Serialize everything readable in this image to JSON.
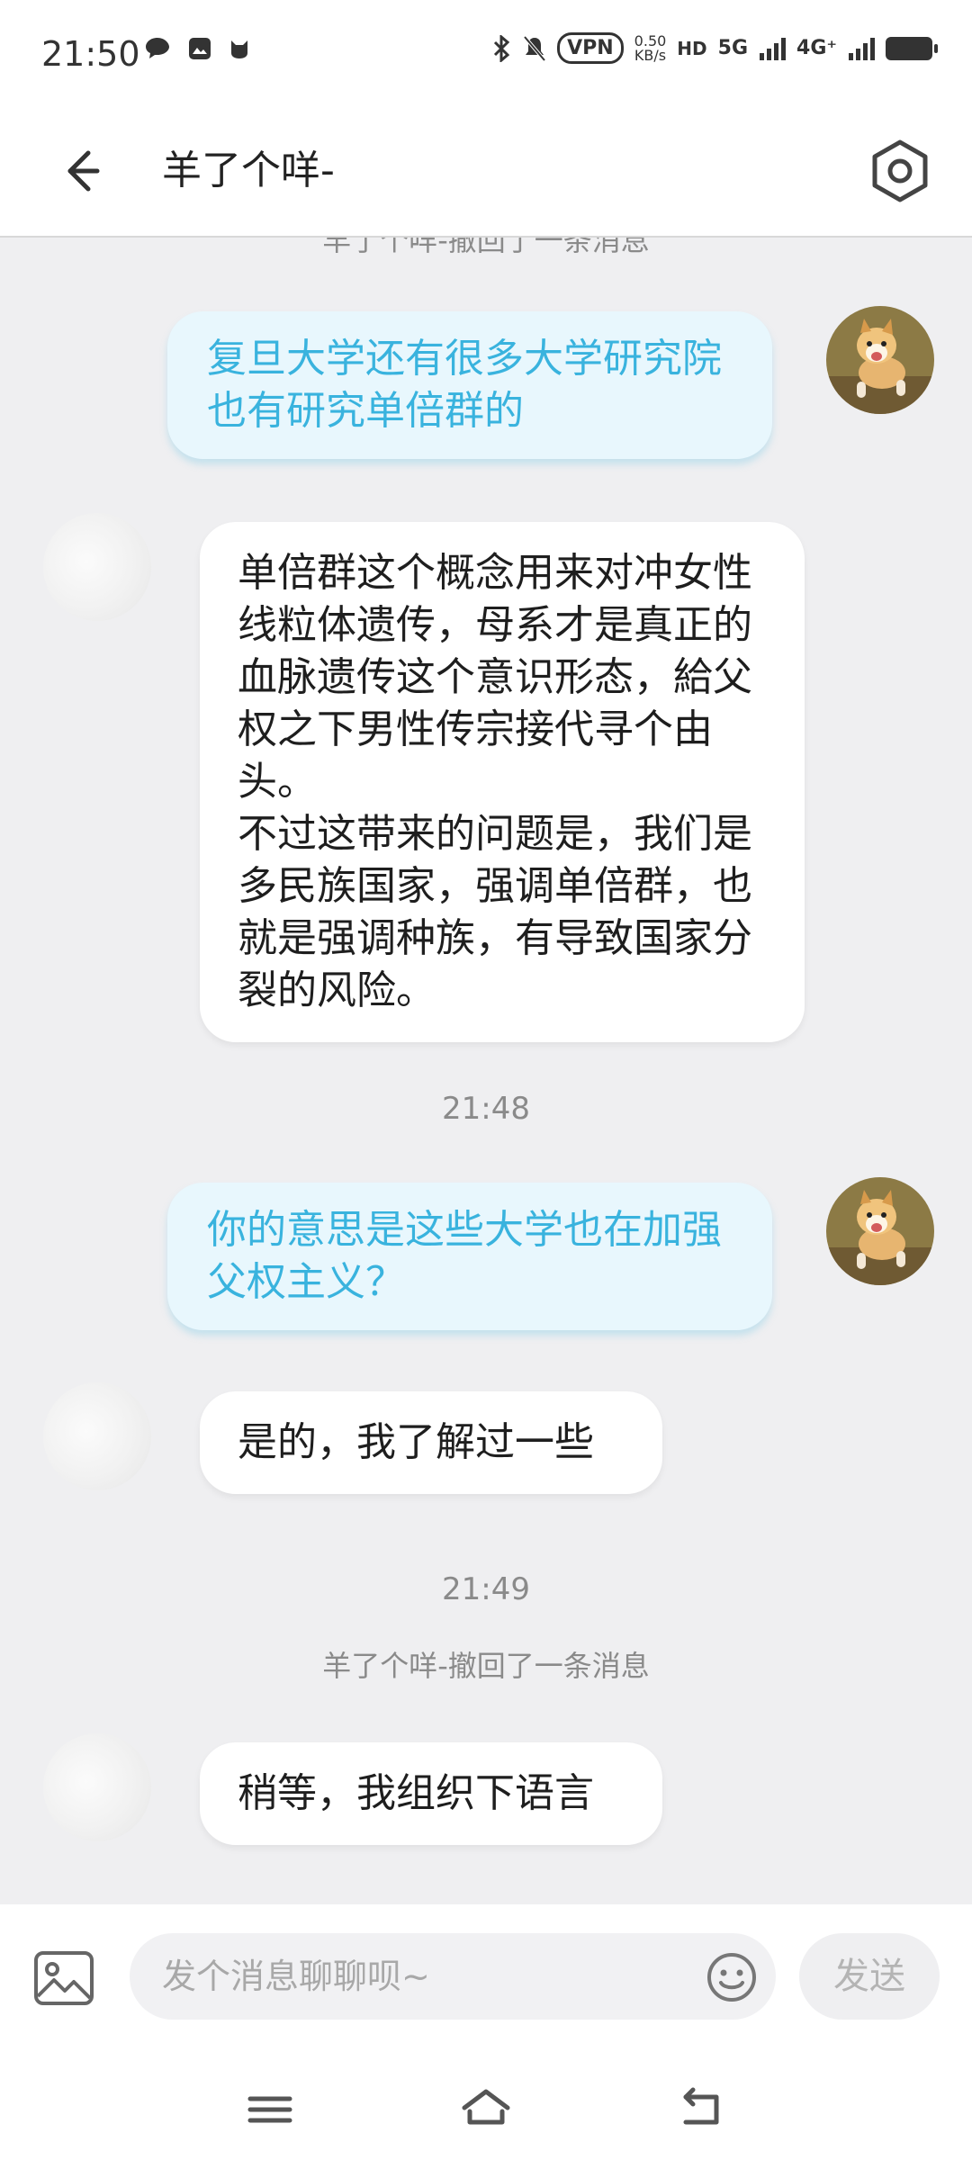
{
  "status_bar": {
    "time": "21:50",
    "vpn_label": "VPN",
    "speed_value": "0.50",
    "speed_unit": "KB/s",
    "hd_label": "HD",
    "net1": "5G",
    "net2": "4G⁺"
  },
  "header": {
    "title": "羊了个咩-",
    "back_icon": "arrow-left-icon",
    "settings_icon": "hexagon-settings-icon"
  },
  "messages": [
    {
      "type": "system",
      "text": "羊了个咩-撤回了一条消息"
    },
    {
      "type": "sent",
      "text": "复旦大学还有很多大学研究院也有研究单倍群的"
    },
    {
      "type": "received",
      "text": "单倍群这个概念用来对冲女性线粒体遗传，母系才是真正的血脉遗传这个意识形态，給父权之下男性传宗接代寻个由头。\n不过这带来的问题是，我们是多民族国家，强调单倍群，也就是强调种族，有导致国家分裂的风险。"
    },
    {
      "type": "timestamp",
      "text": "21:48"
    },
    {
      "type": "sent",
      "text": "你的意思是这些大学也在加强父权主义？"
    },
    {
      "type": "received",
      "text": "是的，我了解过一些"
    },
    {
      "type": "timestamp",
      "text": "21:49"
    },
    {
      "type": "system",
      "text": "羊了个咩-撤回了一条消息"
    },
    {
      "type": "received",
      "text": "稍等，我组织下语言"
    }
  ],
  "input_bar": {
    "placeholder": "发个消息聊聊呗~",
    "send_label": "发送",
    "image_icon": "image-icon",
    "emoji_icon": "smiley-icon"
  },
  "nav_bar": {
    "icons": [
      "menu-icon",
      "home-icon",
      "back-icon"
    ]
  },
  "colors": {
    "sent_bubble_bg": "#e8f7fd",
    "sent_text": "#39b3de",
    "chat_bg": "#efeff1"
  }
}
